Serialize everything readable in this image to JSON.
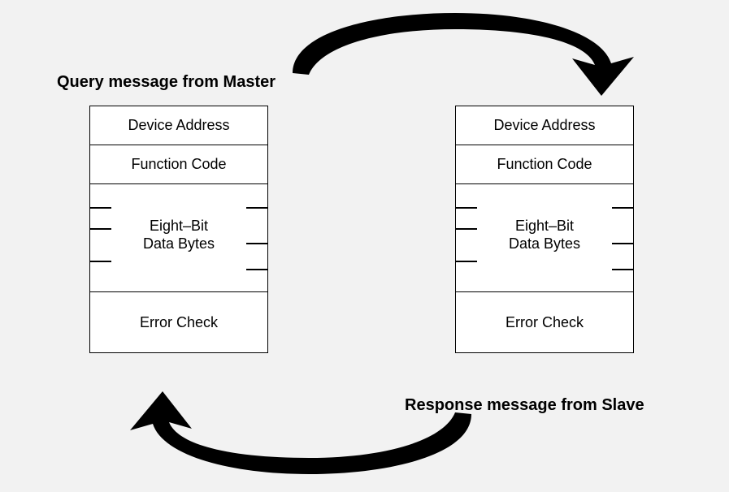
{
  "labels": {
    "query": "Query message from Master",
    "response": "Response message from Slave"
  },
  "box": {
    "device_address": "Device Address",
    "function_code": "Function Code",
    "data_bytes_l1": "Eight–Bit",
    "data_bytes_l2": "Data Bytes",
    "error_check": "Error Check"
  }
}
